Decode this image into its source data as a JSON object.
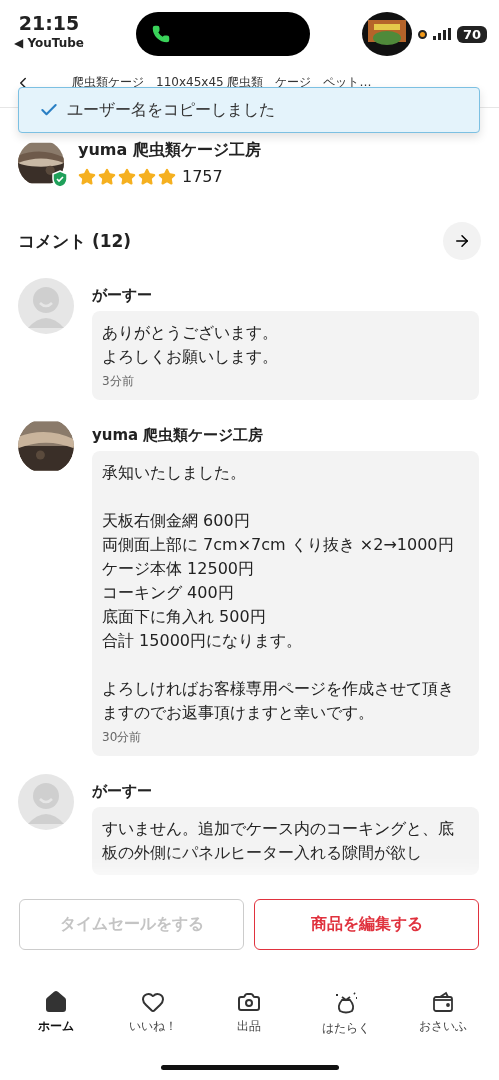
{
  "status_bar": {
    "time": "21:15",
    "back_app": "◀ YouTube",
    "battery": "70"
  },
  "header": {
    "title": "爬虫類ケージ　110x45x45 爬虫類　ケージ　ペット…"
  },
  "toast": {
    "text": "ユーザー名をコピーしました"
  },
  "seller": {
    "name": "yuma 爬虫類ケージ工房",
    "stars": 5,
    "rating_count": "1757",
    "verified": true
  },
  "comments_header": {
    "title": "コメント (12)"
  },
  "comments": [
    {
      "kind": "placeholder",
      "name": "がーすー",
      "paragraphs": [
        [
          "ありがとうございます。",
          "よろしくお願いします。"
        ]
      ],
      "time": "3分前"
    },
    {
      "kind": "picture",
      "name": "yuma 爬虫類ケージ工房",
      "paragraphs": [
        [
          "承知いたしました。"
        ],
        [
          "天板右側金網 600円",
          "両側面上部に 7cm×7cm くり抜き ×2→1000円",
          "ケージ本体 12500円",
          "コーキング 400円",
          "底面下に角入れ 500円",
          "合計 15000円になります。"
        ],
        [
          "よろしければお客様専用ページを作成させて頂きますのでお返事頂けますと幸いです。"
        ]
      ],
      "time": "30分前"
    },
    {
      "kind": "placeholder",
      "name": "がーすー",
      "paragraphs": [
        [
          "すいません。追加でケース内のコーキングと、底板の外側にパネルヒーター入れる隙間が欲し"
        ]
      ]
    }
  ],
  "actions": [
    {
      "label": "タイムセールをする",
      "disabled": true
    },
    {
      "label": "商品を編集する",
      "disabled": false
    }
  ],
  "tabs": [
    {
      "kind": "home",
      "label": "ホーム",
      "selected": true
    },
    {
      "kind": "like",
      "label": "いいね！",
      "selected": false
    },
    {
      "kind": "sell",
      "label": "出品",
      "selected": false
    },
    {
      "kind": "work",
      "label": "はたらく",
      "selected": false
    },
    {
      "kind": "wallet",
      "label": "おさいふ",
      "selected": false
    }
  ]
}
